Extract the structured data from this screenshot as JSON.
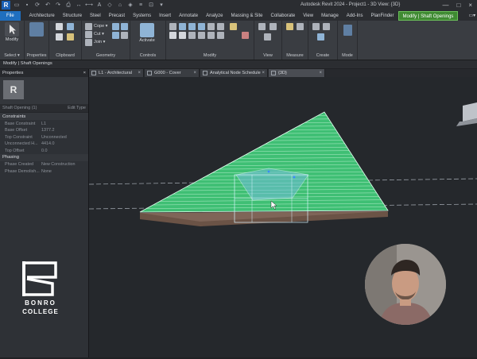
{
  "app": {
    "logo_letter": "R",
    "title": "Autodesk Revit 2024 - Project1 - 3D View: {3D}",
    "window_controls": [
      "—",
      "□",
      "×"
    ]
  },
  "quick_access": [
    "open-icon",
    "save-icon",
    "sync-icon",
    "undo-icon",
    "redo-icon",
    "print-icon",
    "measure-icon",
    "dimension-icon",
    "tag-icon",
    "text-icon",
    "3d-view-icon",
    "section-icon",
    "thin-lines-icon",
    "close-hidden-icon",
    "switch-windows-icon"
  ],
  "ribbon_tabs": [
    {
      "label": "File",
      "type": "file"
    },
    {
      "label": "Architecture"
    },
    {
      "label": "Structure"
    },
    {
      "label": "Steel"
    },
    {
      "label": "Precast"
    },
    {
      "label": "Systems"
    },
    {
      "label": "Insert"
    },
    {
      "label": "Annotate"
    },
    {
      "label": "Analyze"
    },
    {
      "label": "Massing & Site"
    },
    {
      "label": "Collaborate"
    },
    {
      "label": "View"
    },
    {
      "label": "Manage"
    },
    {
      "label": "Add-Ins"
    },
    {
      "label": "PlanFinder"
    },
    {
      "label": "Modify | Shaft Openings",
      "type": "contextual"
    }
  ],
  "ribbon": {
    "modify_label": "Modify",
    "select_label": "Select ▾",
    "properties_label": "Properties",
    "clipboard_label": "Clipboard",
    "cope_label": "Cope ▾",
    "cut_label": "Cut ▾",
    "join_label": "Join ▾",
    "geometry_label": "Geometry",
    "activate_label": "Activate",
    "controls_label": "Controls",
    "modify_panel_label": "Modify",
    "view_label": "View",
    "measure_label": "Measure",
    "create_label": "Create",
    "mode_label": "Mode"
  },
  "options_bar": {
    "text": "Modify | Shaft Openings"
  },
  "properties": {
    "header": "Properties",
    "close": "×",
    "type_badge": "R",
    "type_name": "",
    "selector_left": "Shaft Opening (1)",
    "selector_right": "Edit Type",
    "groups": [
      {
        "name": "Constraints",
        "rows": [
          {
            "k": "Base Constraint",
            "v": "L1"
          },
          {
            "k": "Base Offset",
            "v": "1377.2"
          },
          {
            "k": "Top Constraint",
            "v": "Unconnected"
          },
          {
            "k": "Unconnected H...",
            "v": "4414.0"
          },
          {
            "k": "Top Offset",
            "v": "0.0"
          }
        ]
      },
      {
        "name": "Phasing",
        "rows": [
          {
            "k": "Phase Created",
            "v": "New Construction"
          },
          {
            "k": "Phase Demolish...",
            "v": "None"
          }
        ]
      }
    ]
  },
  "view_tabs": [
    {
      "label": "L1 - Architectural",
      "active": false
    },
    {
      "label": "G000 - Cover",
      "active": false
    },
    {
      "label": "Analytical Node Schedule",
      "active": false
    },
    {
      "label": "{3D}",
      "active": true
    }
  ],
  "watermark": {
    "line1": "BONRO",
    "line2": "COLLEGE"
  },
  "colors": {
    "roof_green": "#3fbf74",
    "file_tab": "#1f6fbf",
    "contextual_tab": "#3f8a32",
    "background": "#25282c"
  }
}
